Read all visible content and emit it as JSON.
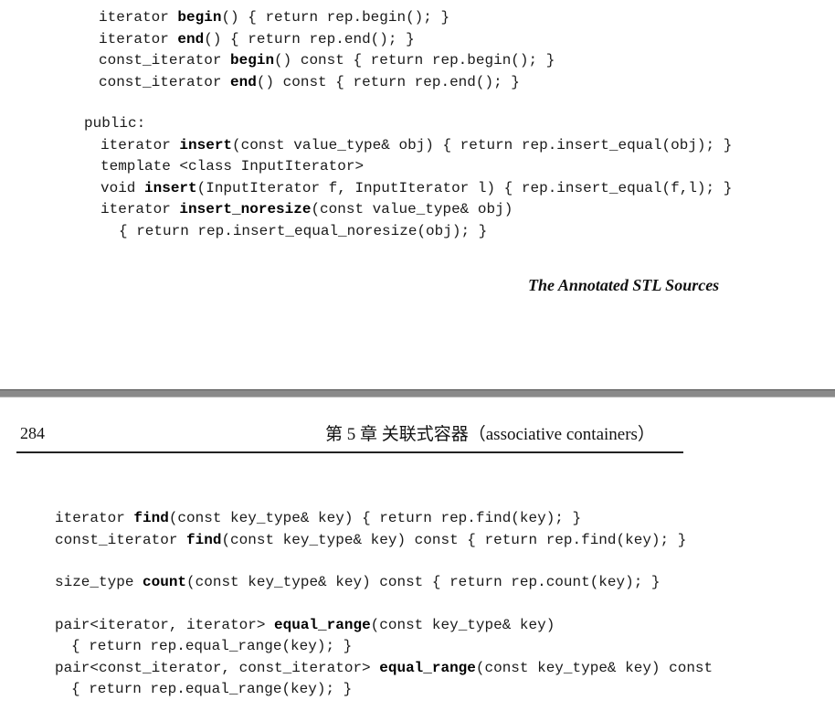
{
  "top_page": {
    "code_lines": [
      {
        "indent": 1,
        "parts": [
          {
            "t": "iterator "
          },
          {
            "t": "begin",
            "b": true
          },
          {
            "t": "() { return rep.begin(); }"
          }
        ]
      },
      {
        "indent": 1,
        "parts": [
          {
            "t": "iterator "
          },
          {
            "t": "end",
            "b": true
          },
          {
            "t": "() { return rep.end(); }"
          }
        ]
      },
      {
        "indent": 1,
        "parts": [
          {
            "t": "const_iterator "
          },
          {
            "t": "begin",
            "b": true
          },
          {
            "t": "() const { return rep.begin(); }"
          }
        ]
      },
      {
        "indent": 1,
        "parts": [
          {
            "t": "const_iterator "
          },
          {
            "t": "end",
            "b": true
          },
          {
            "t": "() const { return rep.end(); }"
          }
        ]
      },
      {
        "gap": true
      },
      {
        "indent": 2,
        "parts": [
          {
            "t": "public:"
          }
        ]
      },
      {
        "indent": 3,
        "parts": [
          {
            "t": "iterator "
          },
          {
            "t": "insert",
            "b": true
          },
          {
            "t": "(const value_type& obj) { return rep.insert_equal(obj); }"
          }
        ]
      },
      {
        "indent": 3,
        "parts": [
          {
            "t": "template <class InputIterator>"
          }
        ]
      },
      {
        "indent": 3,
        "parts": [
          {
            "t": "void "
          },
          {
            "t": "insert",
            "b": true
          },
          {
            "t": "(InputIterator f, InputIterator l) { rep.insert_equal(f,l); }"
          }
        ]
      },
      {
        "indent": 3,
        "parts": [
          {
            "t": "iterator "
          },
          {
            "t": "insert_noresize",
            "b": true
          },
          {
            "t": "(const value_type& obj)"
          }
        ]
      },
      {
        "indent": 4,
        "parts": [
          {
            "t": "{ return rep.insert_equal_noresize(obj); }"
          }
        ]
      }
    ],
    "footer": "The Annotated STL Sources"
  },
  "bottom_page": {
    "page_number": "284",
    "chapter_header": "第 5 章  关联式容器（associative containers）",
    "code_lines": [
      {
        "indent": 1,
        "parts": [
          {
            "t": "iterator "
          },
          {
            "t": "find",
            "b": true
          },
          {
            "t": "(const key_type& key) { return rep.find(key); }"
          }
        ]
      },
      {
        "indent": 1,
        "parts": [
          {
            "t": "const_iterator "
          },
          {
            "t": "find",
            "b": true
          },
          {
            "t": "(const key_type& key) const { return rep.find(key); }"
          }
        ]
      },
      {
        "gap": true
      },
      {
        "indent": 1,
        "parts": [
          {
            "t": "size_type "
          },
          {
            "t": "count",
            "b": true
          },
          {
            "t": "(const key_type& key) const { return rep.count(key); }"
          }
        ]
      },
      {
        "gap": true
      },
      {
        "indent": 1,
        "parts": [
          {
            "t": "pair<iterator, iterator> "
          },
          {
            "t": "equal_range",
            "b": true
          },
          {
            "t": "(const key_type& key)"
          }
        ]
      },
      {
        "indent": 2,
        "parts": [
          {
            "t": "{ return rep.equal_range(key); }"
          }
        ]
      },
      {
        "indent": 1,
        "parts": [
          {
            "t": "pair<const_iterator, const_iterator> "
          },
          {
            "t": "equal_range",
            "b": true
          },
          {
            "t": "(const key_type& key) const"
          }
        ]
      },
      {
        "indent": 2,
        "parts": [
          {
            "t": "{ return rep.equal_range(key); }"
          }
        ]
      }
    ]
  }
}
